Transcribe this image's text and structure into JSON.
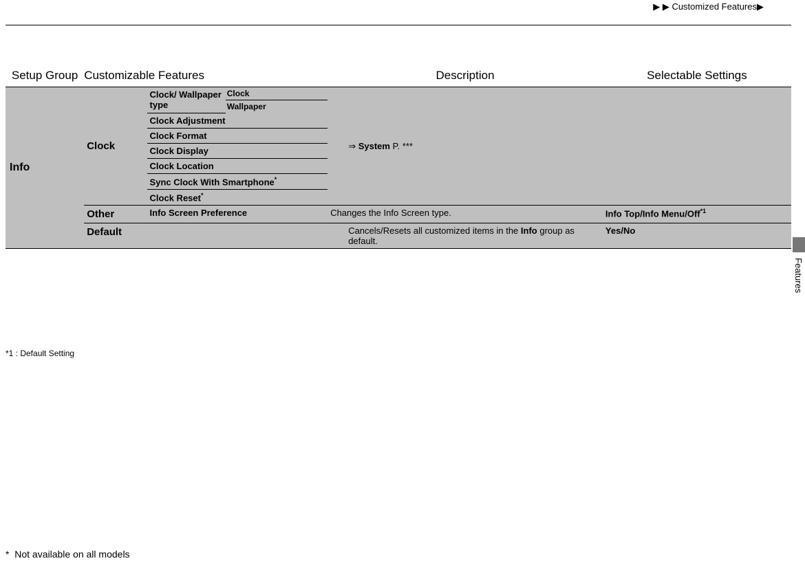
{
  "breadcrumb": {
    "prefix": "▶ ▶ ",
    "text": "Customized Features",
    "suffix": "▶"
  },
  "sideLabel": "Features",
  "headers": {
    "c1": "Setup Group",
    "c2": "Customizable Features",
    "c3": "Description",
    "c4": "Selectable Settings"
  },
  "group": "Info",
  "clock": {
    "label": "Clock",
    "cw_label": "Clock/ Wallpaper type",
    "cw_items": [
      "Clock",
      "Wallpaper"
    ],
    "items": [
      "Clock Adjustment",
      "Clock Format",
      "Clock Display",
      "Clock Location",
      "Sync Clock With Smartphone",
      "Clock Reset"
    ],
    "sync_star": "*",
    "reset_star": "*",
    "desc_prefix": "⇒ ",
    "desc_bold": "System",
    "desc_tail": " P. ***"
  },
  "other": {
    "label": "Other",
    "feature": "Info Screen Preference",
    "desc": "Changes the Info Screen type.",
    "opts": [
      "Info Top",
      "Info Menu",
      "Off"
    ],
    "sep": "/",
    "opt_star": "*1"
  },
  "def": {
    "label": "Default",
    "desc_pre": "Cancels/Resets all customized items in the ",
    "desc_bold": "Info",
    "desc_post": " group as default.",
    "opts": [
      "Yes",
      "No"
    ],
    "sep": "/"
  },
  "foot1": "*1 : Default Setting",
  "foot2_star": "*",
  "foot2": "Not available on all models"
}
